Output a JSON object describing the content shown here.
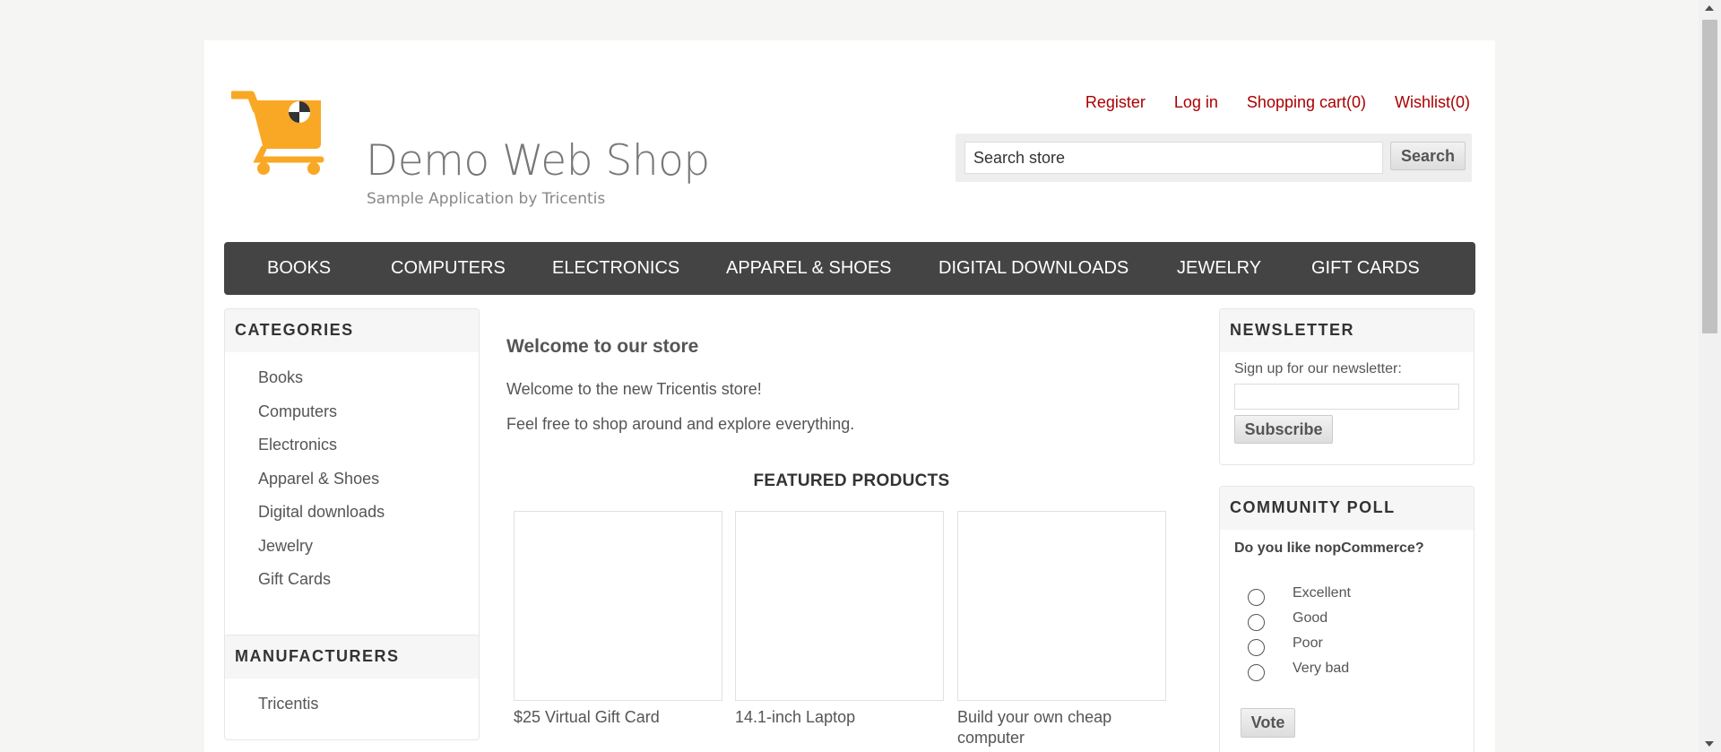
{
  "logo": {
    "title": "Demo Web Shop",
    "subtitle": "Sample Application by Tricentis",
    "colors": {
      "cart": "#f9a825",
      "badge": "#ffffff"
    }
  },
  "header": {
    "links": [
      "Register",
      "Log in",
      "Shopping cart(0)",
      "Wishlist(0)"
    ],
    "link_color": "#aa0000"
  },
  "search": {
    "value": "Search store",
    "button": "Search"
  },
  "menu": {
    "items": [
      "BOOKS",
      "COMPUTERS",
      "ELECTRONICS",
      "APPAREL & SHOES",
      "DIGITAL DOWNLOADS",
      "JEWELRY",
      "GIFT CARDS"
    ],
    "background": "#444444"
  },
  "categories": {
    "title": "CATEGORIES",
    "items": [
      "Books",
      "Computers",
      "Electronics",
      "Apparel & Shoes",
      "Digital downloads",
      "Jewelry",
      "Gift Cards"
    ]
  },
  "manufacturers": {
    "title": "MANUFACTURERS",
    "items": [
      "Tricentis"
    ]
  },
  "main": {
    "welcome_title": "Welcome to our store",
    "welcome_lines": [
      "Welcome to the new Tricentis store!",
      "Feel free to shop around and explore everything."
    ],
    "featured_title": "FEATURED PRODUCTS",
    "products": [
      "$25 Virtual Gift Card",
      "14.1-inch Laptop",
      "Build your own cheap computer"
    ]
  },
  "newsletter": {
    "title": "NEWSLETTER",
    "label": "Sign up for our newsletter:",
    "button": "Subscribe"
  },
  "poll": {
    "title": "COMMUNITY POLL",
    "question": "Do you like nopCommerce?",
    "options": [
      "Excellent",
      "Good",
      "Poor",
      "Very bad"
    ],
    "button": "Vote"
  }
}
